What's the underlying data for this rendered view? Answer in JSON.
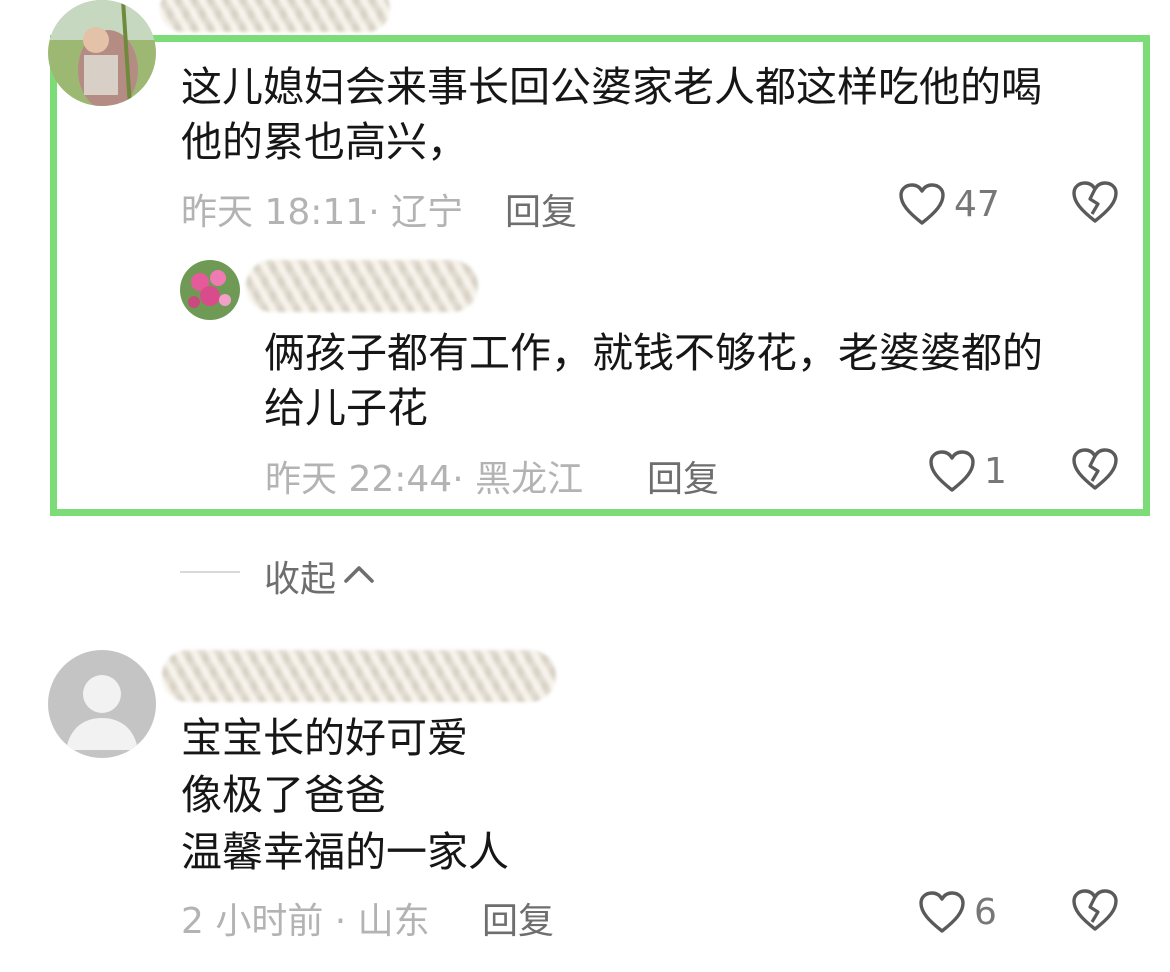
{
  "comments": [
    {
      "text_lines": [
        "这儿媳妇会来事长回公婆家老人都这样吃他的喝",
        "他的累也高兴，"
      ],
      "time_location": "昨天 18:11· 辽宁",
      "reply_label": "回复",
      "likes": "47",
      "replies": [
        {
          "text_lines": [
            "俩孩子都有工作，就钱不够花，老婆婆都的",
            "给儿子花"
          ],
          "time_location": "昨天 22:44· 黑龙江",
          "reply_label": "回复",
          "likes": "1"
        }
      ]
    },
    {
      "text_lines": [
        "宝宝长的好可爱",
        "像极了爸爸",
        "温馨幸福的一家人"
      ],
      "time_location": "2 小时前 · 山东",
      "reply_label": "回复",
      "likes": "6"
    }
  ],
  "collapse_label": "收起",
  "icons": {
    "like": "heart-outline-icon",
    "dislike": "broken-heart-icon",
    "collapse": "chevron-up-icon"
  },
  "colors": {
    "highlight_border": "#7cdc78",
    "meta_text": "#b3b3b3",
    "reply_text": "#6e6e6e"
  }
}
